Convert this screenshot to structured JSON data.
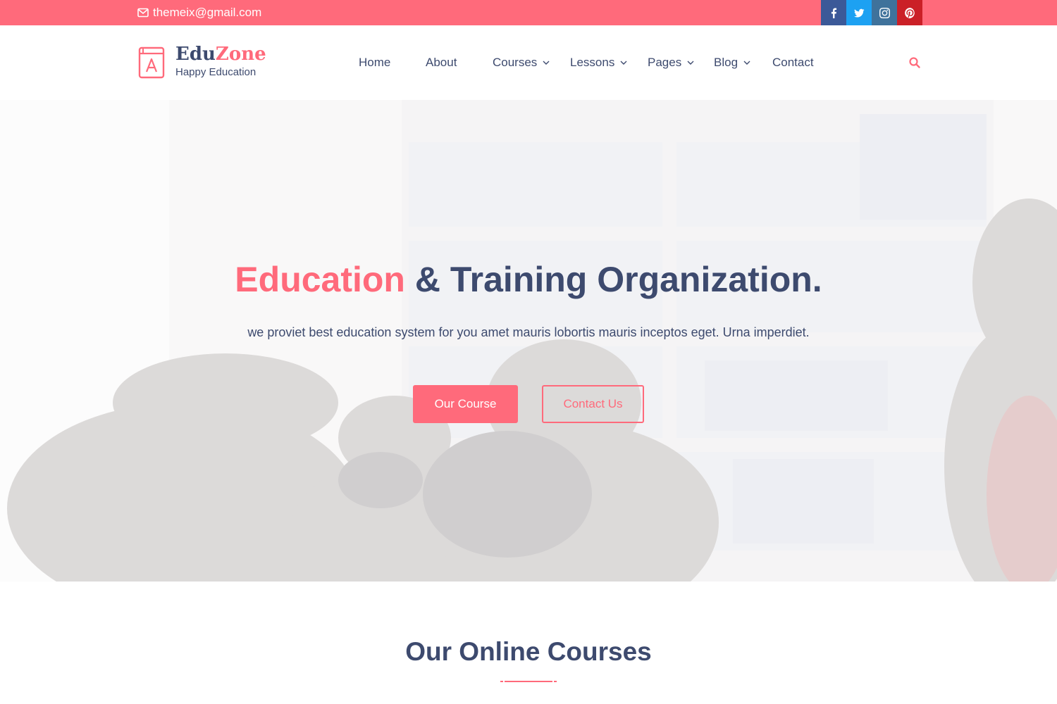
{
  "topbar": {
    "email": "themeix@gmail.com",
    "social": [
      "facebook-icon",
      "twitter-icon",
      "instagram-icon",
      "pinterest-icon"
    ],
    "color": "#ff6a7b"
  },
  "brand": {
    "name_part1": "Edu",
    "name_part2": "Zone",
    "tagline": "Happy Education"
  },
  "nav": {
    "items": [
      {
        "label": "Home",
        "dropdown": false
      },
      {
        "label": "About",
        "dropdown": false
      },
      {
        "label": "Courses",
        "dropdown": true
      },
      {
        "label": "Lessons",
        "dropdown": true
      },
      {
        "label": "Pages",
        "dropdown": true
      },
      {
        "label": "Blog",
        "dropdown": true
      },
      {
        "label": "Contact",
        "dropdown": false
      }
    ],
    "search_icon": "search-icon"
  },
  "hero": {
    "title_accent": "Education",
    "title_rest": " & Training Organization.",
    "subtitle": "we proviet best education system for you amet mauris lobortis mauris inceptos eget. Urna imperdiet.",
    "primary_button": "Our Course",
    "secondary_button": "Contact Us"
  },
  "section": {
    "title": "Our Online Courses"
  },
  "colors": {
    "accent": "#ff6a7b",
    "text": "#3d4a6e"
  }
}
